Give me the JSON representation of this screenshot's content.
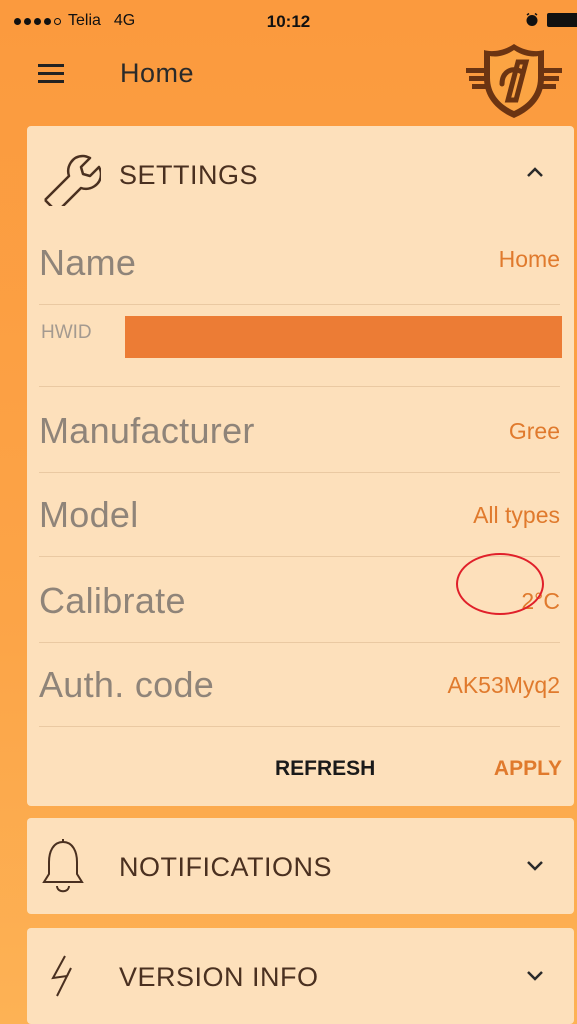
{
  "status_bar": {
    "carrier": "Telia",
    "network": "4G",
    "time": "10:12"
  },
  "header": {
    "title": "Home"
  },
  "settings": {
    "title": "SETTINGS",
    "rows": [
      {
        "label": "Name",
        "value": "Home"
      },
      {
        "label": "HWID",
        "value": ""
      },
      {
        "label": "Manufacturer",
        "value": "Gree"
      },
      {
        "label": "Model",
        "value": "All types"
      },
      {
        "label": "Calibrate",
        "value": "2°C"
      },
      {
        "label": "Auth. code",
        "value": "AK53Myq2"
      }
    ],
    "refresh_label": "REFRESH",
    "apply_label": "APPLY"
  },
  "notifications": {
    "title": "NOTIFICATIONS"
  },
  "version_info": {
    "title": "VERSION INFO"
  },
  "colors": {
    "accent": "#e07a2d",
    "background": "#fb9a3e",
    "card": "#fde0bb",
    "annotation": "#e0202a"
  },
  "icons": [
    "menu-icon",
    "logo-icon",
    "wrench-icon",
    "chevron-up-icon",
    "bell-icon",
    "lightning-icon",
    "chevron-down-icon",
    "alarm-icon",
    "battery-icon"
  ]
}
